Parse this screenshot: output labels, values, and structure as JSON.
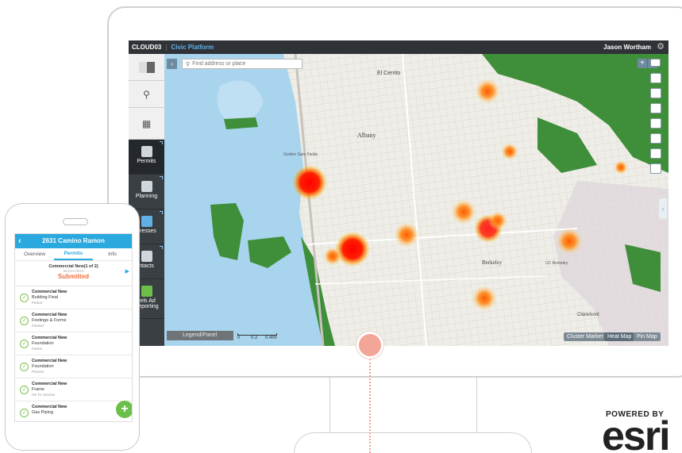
{
  "app": {
    "code": "CLOUD03",
    "separator": "|",
    "platform": "Civic Platform",
    "user": "Jason Wortham"
  },
  "nav": {
    "items": [
      {
        "label": "Permits"
      },
      {
        "label": "Planning"
      },
      {
        "label": "dresses"
      },
      {
        "label": "ntacts"
      },
      {
        "label": "cels Ad"
      },
      {
        "label": "Reporting"
      }
    ]
  },
  "map": {
    "search_placeholder": "Find address or place",
    "legend_label": "Legend/Panel",
    "scale": {
      "zero": "0",
      "mid": "0.2",
      "max": "0.4mi"
    },
    "views": [
      "Cluster Marker",
      "Heat Map",
      "Pin Map"
    ],
    "active_view": "Heat Map",
    "place_labels": [
      "Albany",
      "Berkeley",
      "El Cerrito",
      "Golden Gate Fields",
      "UC Berkeley",
      "Claremont"
    ]
  },
  "mobile": {
    "address": "2631 Camino Ramon",
    "tabs": [
      "Overview",
      "Permits",
      "Info"
    ],
    "summary": {
      "title": "Commercial New(1 of 2)",
      "id": "BLD13-0013",
      "status": "Submitted"
    },
    "inspections": [
      {
        "type": "Commercial New",
        "step": "Building Final",
        "result": "Partial"
      },
      {
        "type": "Commercial New",
        "step": "Footings & Forms",
        "result": "Passed"
      },
      {
        "type": "Commercial New",
        "step": "Foundation",
        "result": "Partial"
      },
      {
        "type": "Commercial New",
        "step": "Foundation",
        "result": "Passed"
      },
      {
        "type": "Commercial New",
        "step": "Frame",
        "result": "OK for Service"
      },
      {
        "type": "Commercial New",
        "step": "Gas Piping",
        "result": ""
      }
    ]
  },
  "branding": {
    "powered_by": "POWERED BY",
    "logo": "esri"
  },
  "colors": {
    "topbar": "#2f3337",
    "accent": "#2aa9df",
    "status": "#ee6f3f",
    "fab": "#6cc04a",
    "pin": "#f3a597"
  }
}
